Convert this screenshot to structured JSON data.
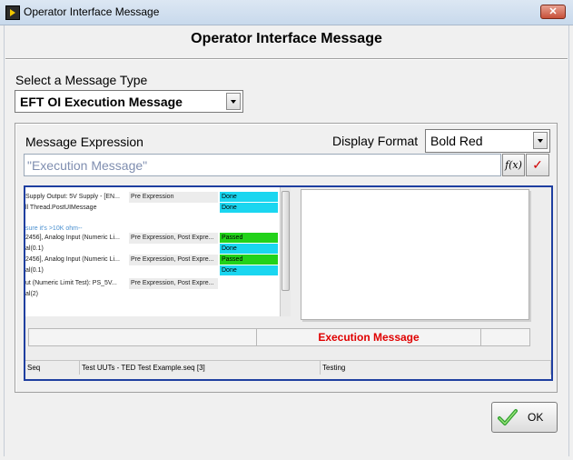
{
  "window": {
    "title": "Operator Interface Message",
    "close_glyph": "✕"
  },
  "header": {
    "title": "Operator Interface Message"
  },
  "message_type": {
    "label": "Select a Message Type",
    "selected": "EFT OI Execution Message"
  },
  "expression": {
    "label": "Message Expression",
    "value": "\"Execution Message\"",
    "fx_label": "f(x)",
    "check_glyph": "✓"
  },
  "display_format": {
    "label": "Display Format",
    "selected": "Bold Red"
  },
  "preview": {
    "rows": [
      {
        "step": "Supply Output: 5V Supply - [EN...",
        "expr": "Pre Expression",
        "status": "Done",
        "status_type": "done"
      },
      {
        "step": "ll Thread.PostUIMessage",
        "expr": "",
        "status": "Done",
        "status_type": "done"
      },
      {
        "step": "",
        "expr": "",
        "status": "",
        "status_type": ""
      },
      {
        "step": "sure it's >10K ohm--",
        "expr": "",
        "status": "",
        "status_type": "comment"
      },
      {
        "step": "2456], Analog Input (Numeric Li...",
        "expr": "Pre Expression, Post Expre...",
        "status": "Passed",
        "status_type": "passed"
      },
      {
        "step": "al(0.1)",
        "expr": "",
        "status": "Done",
        "status_type": "done"
      },
      {
        "step": "2456], Analog Input (Numeric Li...",
        "expr": "Pre Expression, Post Expre...",
        "status": "Passed",
        "status_type": "passed"
      },
      {
        "step": "al(0.1)",
        "expr": "",
        "status": "Done",
        "status_type": "done"
      },
      {
        "step": "ut (Numeric Limit Test): PS_5V...",
        "expr": "Pre Expression, Post Expre...",
        "status": "",
        "status_type": ""
      },
      {
        "step": "al(2)",
        "expr": "",
        "status": "",
        "status_type": ""
      }
    ],
    "message_bar_text": "Execution Message",
    "status_bar": [
      {
        "text": "Seq"
      },
      {
        "text": "Test UUTs - TED Test Example.seq [3]"
      },
      {
        "text": "Testing"
      }
    ],
    "colors": {
      "done": "#1ad6f0",
      "passed": "#22d21a",
      "message": "#e00000",
      "frame": "#1f3fa0"
    }
  },
  "ok_button": {
    "label": "OK"
  }
}
